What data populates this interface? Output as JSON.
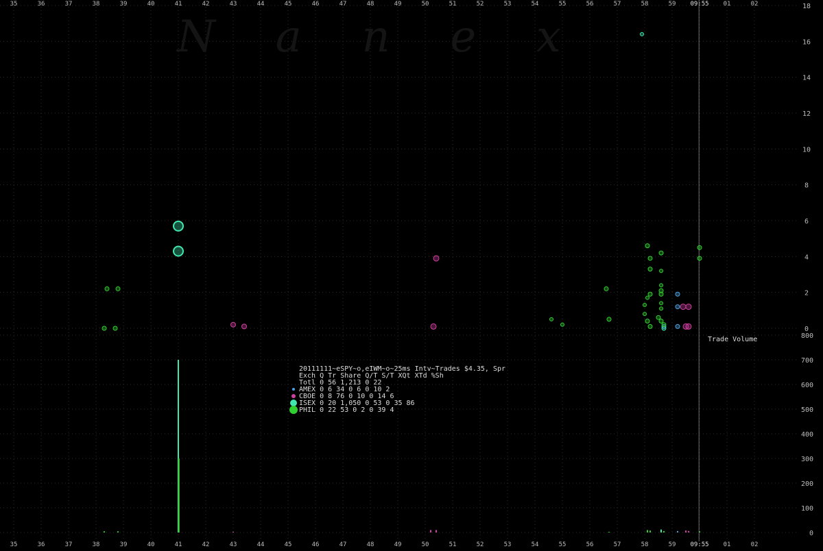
{
  "watermark": "N a n e x",
  "colors": {
    "background": "#000000",
    "grid": "#2c2c2c",
    "axis_text": "#bdbdbd",
    "time_marker": "#6e6e6e",
    "amex": "#4aa0e0",
    "cboe": "#d040a0",
    "isex": "#40e8b0",
    "phil": "#30d030"
  },
  "chart_data": {
    "type": "scatter",
    "x_axis": {
      "tick_labels": [
        "35",
        "36",
        "37",
        "38",
        "39",
        "40",
        "41",
        "42",
        "43",
        "44",
        "45",
        "46",
        "47",
        "48",
        "49",
        "50",
        "51",
        "52",
        "53",
        "54",
        "55",
        "56",
        "57",
        "58",
        "59",
        "09:55",
        "01",
        "02"
      ],
      "highlight_label": "09:55"
    },
    "price_panel": {
      "ylim": [
        0,
        18
      ],
      "y_ticks": [
        0,
        2,
        4,
        6,
        8,
        10,
        12,
        14,
        16,
        18
      ],
      "grid": true
    },
    "volume_panel": {
      "ylim": [
        0,
        800
      ],
      "y_ticks": [
        0,
        100,
        200,
        300,
        400,
        500,
        600,
        700,
        800
      ],
      "grid": true,
      "label": "Trade Volume"
    },
    "time_marker_x": 59.98,
    "series": [
      {
        "name": "AMEX",
        "color_key": "amex",
        "points": [
          {
            "x": 58.7,
            "y": 0.1,
            "s": 4
          },
          {
            "x": 59.2,
            "y": 0.1,
            "s": 4
          },
          {
            "x": 59.2,
            "y": 1.2,
            "s": 4
          },
          {
            "x": 59.2,
            "y": 1.9,
            "s": 4
          }
        ]
      },
      {
        "name": "CBOE",
        "color_key": "cboe",
        "points": [
          {
            "x": 43.0,
            "y": 0.2,
            "s": 5
          },
          {
            "x": 43.4,
            "y": 0.1,
            "s": 5
          },
          {
            "x": 50.3,
            "y": 0.1,
            "s": 6
          },
          {
            "x": 50.4,
            "y": 3.9,
            "s": 6
          },
          {
            "x": 59.4,
            "y": 1.2,
            "s": 6
          },
          {
            "x": 59.6,
            "y": 1.2,
            "s": 6
          },
          {
            "x": 59.5,
            "y": 0.1,
            "s": 6
          },
          {
            "x": 59.6,
            "y": 0.1,
            "s": 6
          }
        ]
      },
      {
        "name": "ISEX",
        "color_key": "isex",
        "points": [
          {
            "x": 41.0,
            "y": 5.7,
            "s": 12
          },
          {
            "x": 41.0,
            "y": 4.3,
            "s": 12
          },
          {
            "x": 57.9,
            "y": 16.4,
            "s": 3
          },
          {
            "x": 58.7,
            "y": 0.0,
            "s": 4
          }
        ]
      },
      {
        "name": "PHIL",
        "color_key": "phil",
        "points": [
          {
            "x": 38.3,
            "y": 0.0,
            "s": 4
          },
          {
            "x": 38.4,
            "y": 2.2,
            "s": 4
          },
          {
            "x": 38.7,
            "y": 0.0,
            "s": 4
          },
          {
            "x": 38.8,
            "y": 2.2,
            "s": 4
          },
          {
            "x": 54.6,
            "y": 0.5,
            "s": 3
          },
          {
            "x": 55.0,
            "y": 0.2,
            "s": 3
          },
          {
            "x": 56.6,
            "y": 2.2,
            "s": 4
          },
          {
            "x": 56.7,
            "y": 0.5,
            "s": 4
          },
          {
            "x": 58.1,
            "y": 4.6,
            "s": 4
          },
          {
            "x": 58.2,
            "y": 3.9,
            "s": 4
          },
          {
            "x": 58.1,
            "y": 1.7,
            "s": 3
          },
          {
            "x": 58.2,
            "y": 1.9,
            "s": 4
          },
          {
            "x": 58.0,
            "y": 1.3,
            "s": 3
          },
          {
            "x": 58.0,
            "y": 0.8,
            "s": 3
          },
          {
            "x": 58.1,
            "y": 0.4,
            "s": 4
          },
          {
            "x": 58.2,
            "y": 0.1,
            "s": 4
          },
          {
            "x": 58.2,
            "y": 3.3,
            "s": 4
          },
          {
            "x": 58.6,
            "y": 4.2,
            "s": 4
          },
          {
            "x": 58.6,
            "y": 3.2,
            "s": 3
          },
          {
            "x": 58.6,
            "y": 2.4,
            "s": 3
          },
          {
            "x": 58.6,
            "y": 2.1,
            "s": 4
          },
          {
            "x": 58.6,
            "y": 1.9,
            "s": 4
          },
          {
            "x": 58.6,
            "y": 1.4,
            "s": 3
          },
          {
            "x": 58.6,
            "y": 1.1,
            "s": 3
          },
          {
            "x": 58.5,
            "y": 0.6,
            "s": 4
          },
          {
            "x": 58.6,
            "y": 0.4,
            "s": 4
          },
          {
            "x": 58.7,
            "y": 0.2,
            "s": 4
          },
          {
            "x": 60.0,
            "y": 4.5,
            "s": 4
          },
          {
            "x": 60.0,
            "y": 3.9,
            "s": 4
          }
        ]
      }
    ],
    "volume_bars": [
      {
        "x": 38.3,
        "v": 5,
        "color_key": "phil"
      },
      {
        "x": 38.8,
        "v": 5,
        "color_key": "phil"
      },
      {
        "x": 41.0,
        "v": 700,
        "color_key": "isex"
      },
      {
        "x": 41.02,
        "v": 300,
        "color_key": "phil"
      },
      {
        "x": 43.0,
        "v": 3,
        "color_key": "cboe"
      },
      {
        "x": 50.2,
        "v": 10,
        "color_key": "cboe"
      },
      {
        "x": 50.4,
        "v": 10,
        "color_key": "cboe"
      },
      {
        "x": 56.7,
        "v": 3,
        "color_key": "phil"
      },
      {
        "x": 58.1,
        "v": 10,
        "color_key": "phil"
      },
      {
        "x": 58.2,
        "v": 8,
        "color_key": "phil"
      },
      {
        "x": 58.6,
        "v": 12,
        "color_key": "isex"
      },
      {
        "x": 58.7,
        "v": 6,
        "color_key": "phil"
      },
      {
        "x": 59.2,
        "v": 6,
        "color_key": "amex"
      },
      {
        "x": 59.5,
        "v": 8,
        "color_key": "cboe"
      },
      {
        "x": 59.6,
        "v": 6,
        "color_key": "cboe"
      },
      {
        "x": 60.0,
        "v": 5,
        "color_key": "phil"
      }
    ]
  },
  "stats_table": {
    "title": "20111111~eSPY~o,eIWM~o~25ms Intv~Trades $4.35, Spr",
    "header": "Exch Q Tr Share  Q/T   S/T  XQt XTd %Sh",
    "rows": [
      {
        "text": "Totl 0 56 1,213     0    22",
        "marker": null
      },
      {
        "text": "AMEX 0  6    34     0     6   0  10   2",
        "marker": "amex"
      },
      {
        "text": "CBOE 0  8    76     0    10   0  14   6",
        "marker": "cboe"
      },
      {
        "text": "ISEX 0 20 1,050     0    53   0  35  86",
        "marker": "isex"
      },
      {
        "text": "PHIL 0 22    53     0     2   0  39   4",
        "marker": "phil"
      }
    ]
  }
}
